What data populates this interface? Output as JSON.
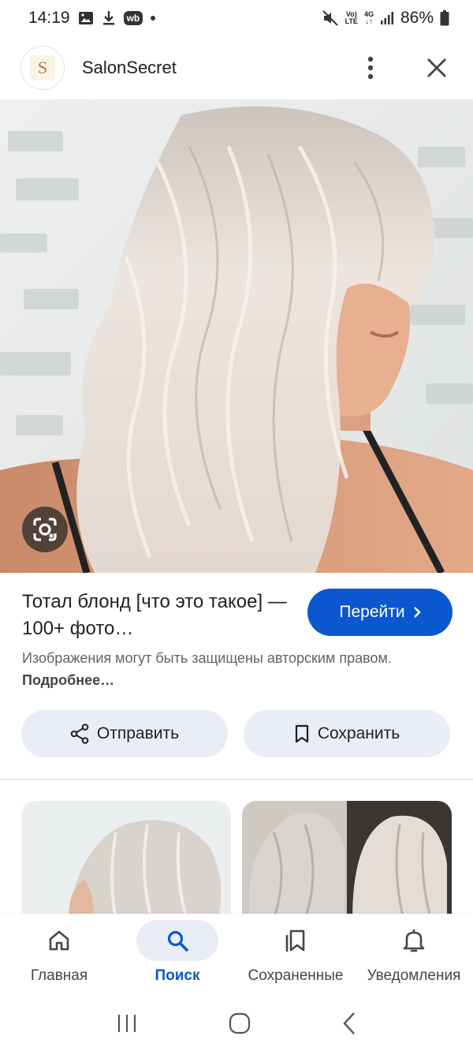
{
  "status_bar": {
    "time": "14:19",
    "wb_badge": "wb",
    "network_top": "Vo)",
    "network_bottom": "LTE",
    "data_top": "4G",
    "data_bottom": "↓↑",
    "battery": "86%"
  },
  "header": {
    "site_initial": "S",
    "site_name": "SalonSecret"
  },
  "result": {
    "title": "Тотал блонд [что это такое] — 100+ фото…",
    "visit_label": "Перейти",
    "copyright_text": "Изображения могут быть защищены авторским правом.",
    "copyright_link": "Подробнее…"
  },
  "actions": {
    "share_label": "Отправить",
    "save_label": "Сохранить"
  },
  "bottom_nav": {
    "items": [
      {
        "label": "Главная",
        "icon": "home-icon",
        "active": false
      },
      {
        "label": "Поиск",
        "icon": "search-icon",
        "active": true
      },
      {
        "label": "Сохраненные",
        "icon": "collections-icon",
        "active": false
      },
      {
        "label": "Уведомления",
        "icon": "bell-icon",
        "active": false
      }
    ]
  },
  "colors": {
    "accent": "#0b57d0",
    "tonal_button": "#e9eef6"
  }
}
